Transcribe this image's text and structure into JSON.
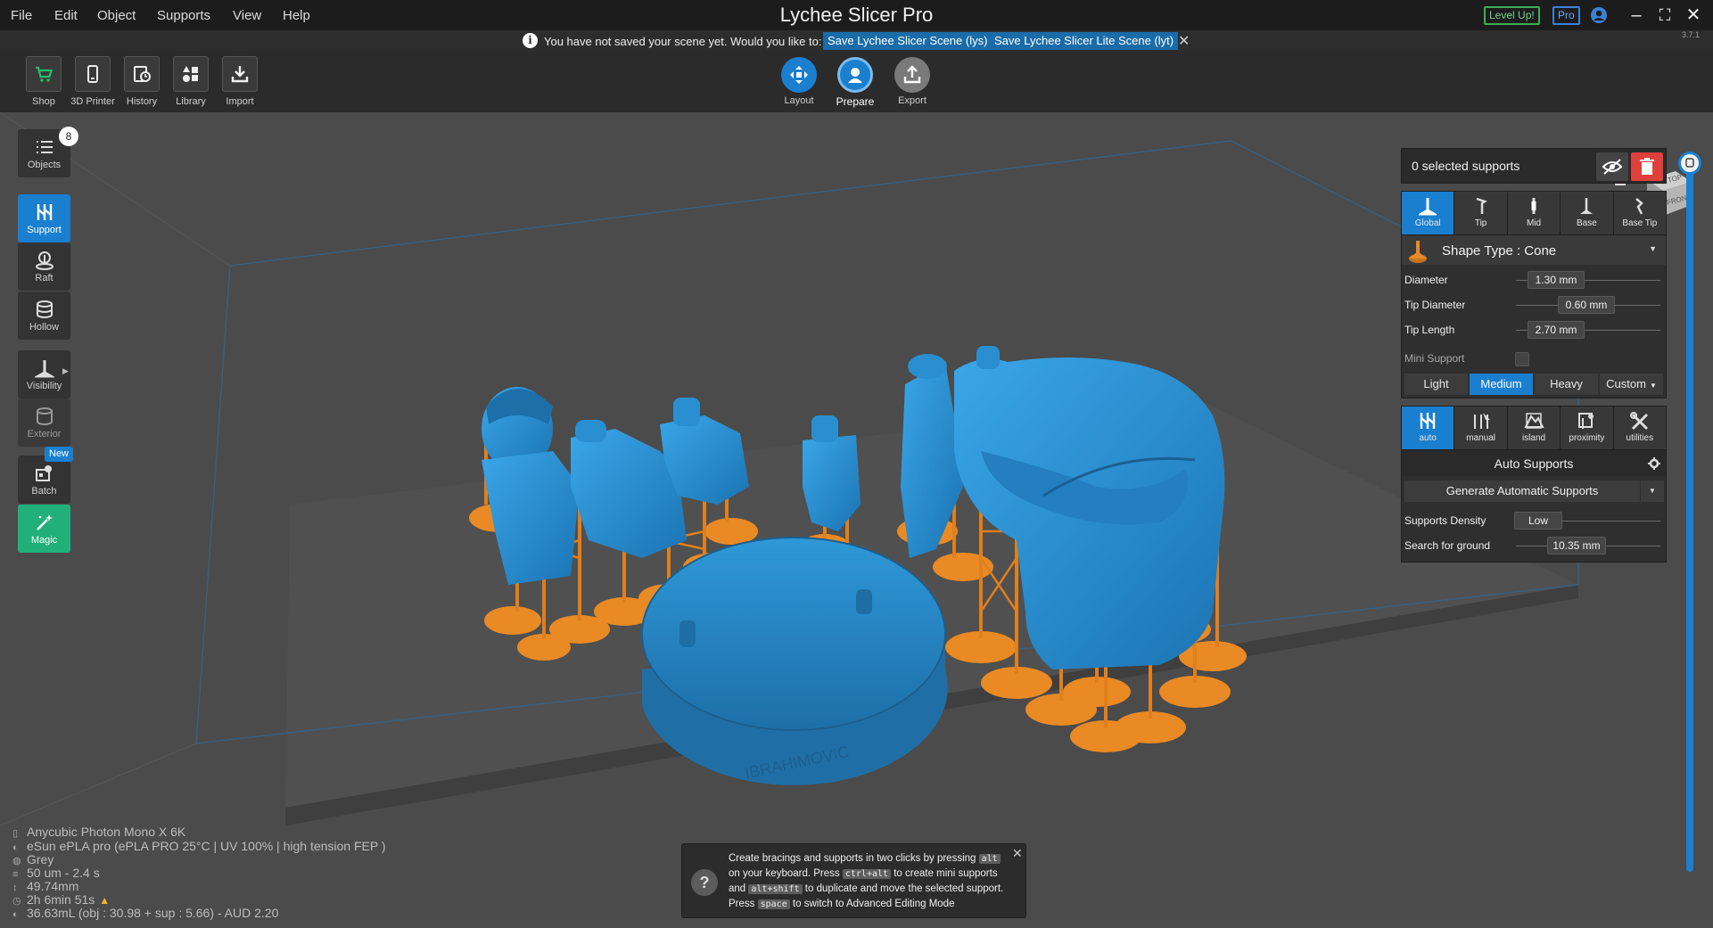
{
  "menu": [
    "File",
    "Edit",
    "Object",
    "Supports",
    "View",
    "Help"
  ],
  "app_title": "Lychee Slicer Pro",
  "titlebar": {
    "levelup": "Level Up!",
    "pro": "Pro"
  },
  "version": "3.7.1",
  "notification": {
    "text": "You have not saved your scene yet. Would you like to:",
    "save_lys": "Save Lychee Slicer Scene (lys)",
    "save_lyt": "Save Lychee Slicer Lite Scene (lyt)"
  },
  "toolbar": {
    "tools": [
      {
        "label": "Shop",
        "icon": "cart-icon"
      },
      {
        "label": "3D Printer",
        "icon": "printer-icon"
      },
      {
        "label": "History",
        "icon": "history-icon"
      },
      {
        "label": "Library",
        "icon": "library-icon"
      },
      {
        "label": "Import",
        "icon": "import-icon"
      }
    ],
    "steps": [
      {
        "label": "Layout"
      },
      {
        "label": "Prepare"
      },
      {
        "label": "Export"
      }
    ]
  },
  "viewcube": {
    "top": "TOP",
    "front": "FRONT"
  },
  "sidebar": {
    "objects_label": "Objects",
    "objects_count": "8",
    "support_label": "Support",
    "raft_label": "Raft",
    "hollow_label": "Hollow",
    "visibility_label": "Visibility",
    "exterior_label": "Exterior",
    "batch_label": "Batch",
    "batch_badge": "New",
    "magic_label": "Magic"
  },
  "panel": {
    "selected": "0 selected supports",
    "tabs": [
      "Global",
      "Tip",
      "Mid",
      "Base",
      "Base Tip"
    ],
    "shape_type": "Shape Type : Cone",
    "diameter_label": "Diameter",
    "diameter_value": "1.30 mm",
    "tip_diameter_label": "Tip Diameter",
    "tip_diameter_value": "0.60 mm",
    "tip_length_label": "Tip Length",
    "tip_length_value": "2.70 mm",
    "mini_support_label": "Mini Support",
    "levels": [
      "Light",
      "Medium",
      "Heavy",
      "Custom"
    ],
    "mode_tabs": [
      "auto",
      "manual",
      "island",
      "proximity",
      "utilities"
    ],
    "auto_title": "Auto Supports",
    "generate_label": "Generate Automatic Supports",
    "density_label": "Supports Density",
    "density_value": "Low",
    "search_ground_label": "Search for ground",
    "search_ground_value": "10.35 mm"
  },
  "model": {
    "base_text": "IBRAHIMOVIC"
  },
  "info": {
    "printer": "Anycubic Photon Mono X 6K",
    "resin": "eSun ePLA pro (ePLA PRO 25°C | UV 100% | high tension FEP )",
    "color": "Grey",
    "layer": "50 um - 2.4 s",
    "height": "49.74mm",
    "time": "2h 6min 51s",
    "volume": "36.63mL (obj : 30.98 + sup : 5.66) - AUD 2.20"
  },
  "hint": {
    "l1a": "Create bracings and supports in two clicks by pressing",
    "k1": "alt",
    "l2a": "on your keyboard. Press",
    "k2": "ctrl+alt",
    "l2b": "to create mini supports",
    "l3a": "and",
    "k3": "alt+shift",
    "l3b": "to duplicate and move the selected support.",
    "l4a": "Press",
    "k4": "space",
    "l4b": "to switch to Advanced Editing Mode"
  },
  "colors": {
    "accent": "#1a7fcf",
    "model": "#2a93d5",
    "support": "#e98a25",
    "magic": "#21b07a"
  }
}
